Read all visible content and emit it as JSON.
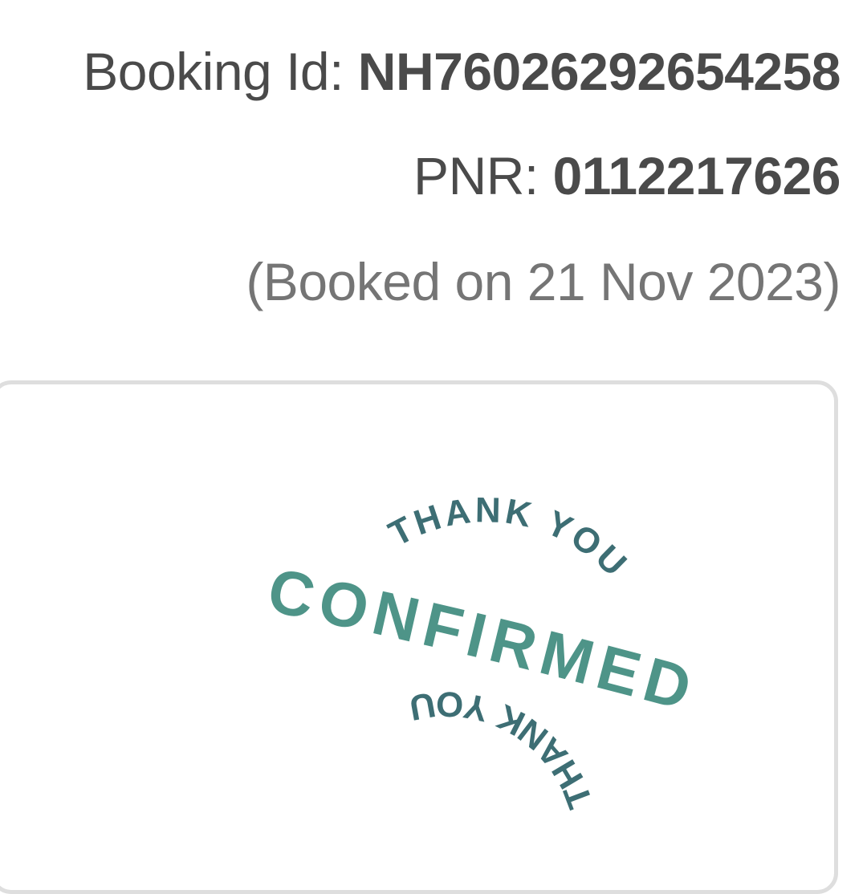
{
  "booking": {
    "id_label": "Booking Id: ",
    "id_value": "NH76026292654258",
    "pnr_label": "PNR: ",
    "pnr_value": "0112217626",
    "booked_on": "(Booked on 21 Nov 2023)"
  },
  "stamp": {
    "top_text": "THANK YOU",
    "main_text": "CONFIRMED",
    "bottom_text": "THANK YOU",
    "colors": {
      "main": "#4e9488",
      "arc": "#3d6e74"
    }
  }
}
